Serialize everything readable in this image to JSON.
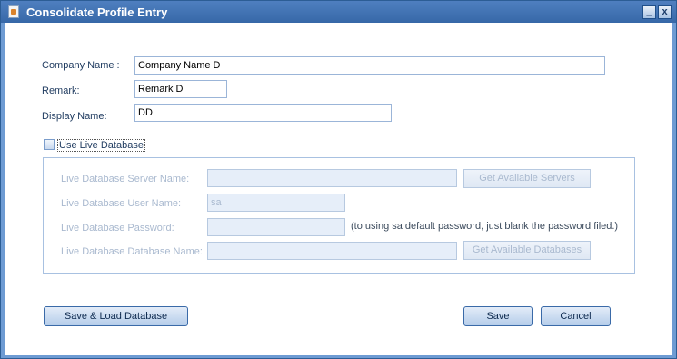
{
  "window": {
    "title": "Consolidate Profile Entry",
    "minimize_glyph": "_",
    "close_glyph": "x"
  },
  "form": {
    "company_name_label": "Company Name :",
    "company_name_value": "Company Name D",
    "remark_label": "Remark:",
    "remark_value": "Remark D",
    "display_name_label": "Display Name:",
    "display_name_value": "DD",
    "use_live_db_label": "Use Live Database",
    "use_live_db_checked": false
  },
  "live_db": {
    "server_name_label": "Live Database Server Name:",
    "server_name_value": "",
    "get_servers_button": "Get Available Servers",
    "user_name_label": "Live Database User Name:",
    "user_name_value": "sa",
    "password_label": "Live Database Password:",
    "password_value": "",
    "password_hint": "(to using sa default password, just blank the password filed.)",
    "database_name_label": "Live Database Database Name:",
    "database_name_value": "",
    "get_databases_button": "Get Available Databases"
  },
  "actions": {
    "save_load_button": "Save & Load Database",
    "save_button": "Save",
    "cancel_button": "Cancel"
  },
  "icons": {
    "window_icon": "document-icon"
  }
}
